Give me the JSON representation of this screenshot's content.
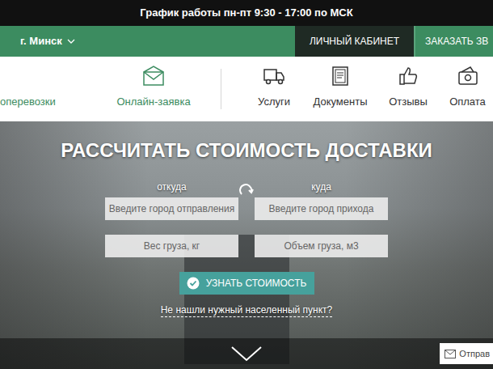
{
  "schedule": "График работы пн-пт 9:30 - 17:00 по МСК",
  "header": {
    "city": "г. Минск",
    "account": "ЛИЧНЫЙ КАБИНЕТ",
    "order": "ЗАКАЗАТЬ ЗВ"
  },
  "menu": [
    {
      "label": "оперевозки",
      "kind": "accent"
    },
    {
      "label": "Онлайн-заявка",
      "kind": "accent"
    },
    {
      "label": "Услуги",
      "kind": "plain"
    },
    {
      "label": "Документы",
      "kind": "plain"
    },
    {
      "label": "Отзывы",
      "kind": "plain"
    },
    {
      "label": "Оплата",
      "kind": "plain"
    }
  ],
  "calculator": {
    "title": "РАССЧИТАТЬ СТОИМОСТЬ ДОСТАВКИ",
    "from_label": "откуда",
    "to_label": "куда",
    "from_placeholder": "Введите город отправления",
    "to_placeholder": "Введите город прихода",
    "weight_placeholder": "Вес груза, кг",
    "volume_placeholder": "Объем груза, м3",
    "button": "УЗНАТЬ СТОИМОСТЬ",
    "link": "Не нашли нужный населенный пункт?"
  },
  "send_button": "Отправ"
}
